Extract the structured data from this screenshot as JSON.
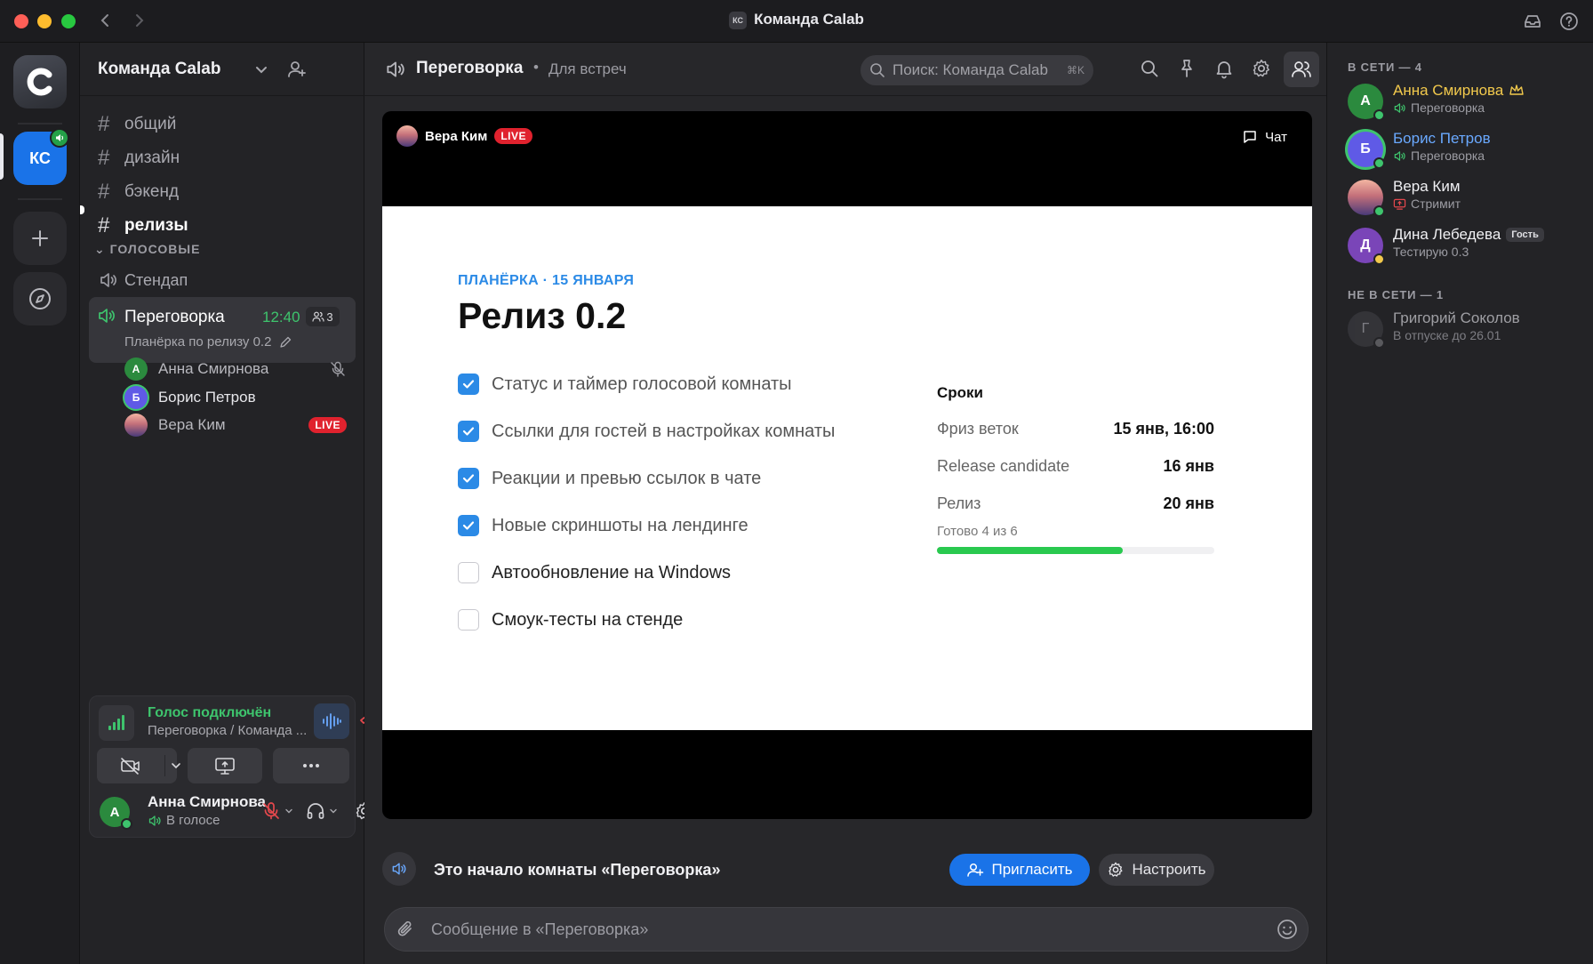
{
  "window": {
    "title": "Команда Calab",
    "badge": "КС"
  },
  "rail": {
    "server_initials": "КС"
  },
  "sidebar": {
    "title": "Команда Calab",
    "text_channels": [
      {
        "name": "общий"
      },
      {
        "name": "дизайн"
      },
      {
        "name": "бэкенд"
      },
      {
        "name": "релизы"
      }
    ],
    "voice_category": "ГОЛОСОВЫЕ",
    "voice_channels": [
      {
        "name": "Стендап"
      },
      {
        "name": "Переговорка",
        "time": "12:40",
        "count": "3",
        "topic": "Планёрка по релизу 0.2"
      }
    ],
    "voice_members": [
      {
        "name": "Анна Смирнова",
        "initial": "А",
        "color": "#2b8a3e"
      },
      {
        "name": "Борис Петров",
        "initial": "Б",
        "color": "#5f5ae6"
      },
      {
        "name": "Вера Ким",
        "live": "LIVE"
      }
    ]
  },
  "voice_panel": {
    "title": "Голос подключён",
    "subtitle": "Переговорка / Команда ..."
  },
  "user": {
    "name": "Анна Смирнова",
    "initial": "А",
    "status": "В голосе"
  },
  "header": {
    "channel": "Переговорка",
    "description": "Для встреч",
    "search_placeholder": "Поиск: Команда Calab",
    "search_shortcut": "⌘K"
  },
  "stream": {
    "streamer": "Вера Ким",
    "live": "LIVE",
    "chat": "Чат",
    "slide": {
      "kicker": "ПЛАНЁРКА · 15 ЯНВАРЯ",
      "title": "Релиз 0.2",
      "checklist": [
        {
          "text": "Статус и таймер голосовой комнаты",
          "done": true
        },
        {
          "text": "Ссылки для гостей в настройках комнаты",
          "done": true
        },
        {
          "text": "Реакции и превью ссылок в чате",
          "done": true
        },
        {
          "text": "Новые скриншоты на лендинге",
          "done": true
        },
        {
          "text": "Автообновление на Windows",
          "done": false
        },
        {
          "text": "Смоук-тесты на стенде",
          "done": false
        }
      ],
      "deadlines_title": "Сроки",
      "deadlines": [
        {
          "label": "Фриз веток",
          "value": "15 янв, 16:00"
        },
        {
          "label": "Release candidate",
          "value": "16 янв"
        },
        {
          "label": "Релиз",
          "value": "20 янв"
        }
      ],
      "progress_label": "Готово 4 из 6",
      "progress_fraction": 0.67
    }
  },
  "room": {
    "start_text": "Это начало комнаты «Переговорка»",
    "invite": "Пригласить",
    "configure": "Настроить",
    "composer_placeholder": "Сообщение в «Переговорка»"
  },
  "members": {
    "online_header": "В СЕТИ — 4",
    "online": [
      {
        "name": "Анна Смирнова",
        "initial": "А",
        "status": "Переговорка",
        "name_color": "#f2c94c",
        "avatar": "#2b8a3e",
        "dot": "#3ec46d"
      },
      {
        "name": "Борис Петров",
        "initial": "Б",
        "status": "Переговорка",
        "name_color": "#6aa9ff",
        "avatar": "#5f5ae6",
        "dot": "#3ec46d"
      },
      {
        "name": "Вера Ким",
        "status": "Стримит",
        "name_color": "#f0f0f3",
        "dot": "#3ec46d"
      },
      {
        "name": "Дина Лебедева",
        "initial": "Д",
        "status": "Тестирую 0.3",
        "tag": "Гость",
        "name_color": "#f0f0f3",
        "avatar": "#7a45b8",
        "dot": "#f2c94c"
      }
    ],
    "offline_header": "НЕ В СЕТИ — 1",
    "offline": [
      {
        "name": "Григорий Соколов",
        "initial": "Г",
        "status": "В отпуске до 26.01"
      }
    ]
  }
}
